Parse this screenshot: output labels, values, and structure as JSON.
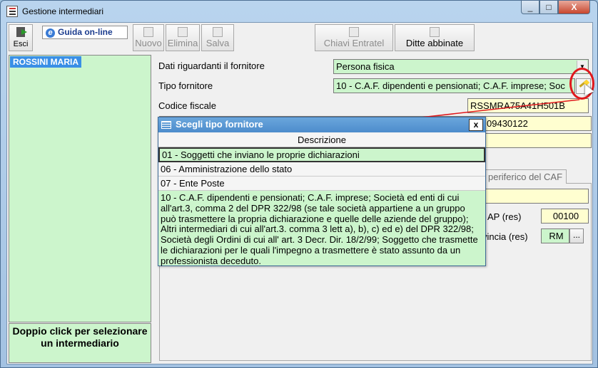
{
  "window": {
    "title": "Gestione intermediari",
    "min_label": "_",
    "max_label": "□",
    "close_label": "X"
  },
  "toolbar": {
    "esci": "Esci",
    "guida": "Guida on-line",
    "nuovo": "Nuovo",
    "elimina": "Elimina",
    "salva": "Salva",
    "chiavi_entratel": "Chiavi Entratel",
    "ditte_abbinate": "Ditte abbinate"
  },
  "list": {
    "items": [
      {
        "label": "ROSSINI MARIA"
      }
    ],
    "help": "Doppio click per selezionare un intermediario"
  },
  "form": {
    "dati_label": "Dati riguardanti il fornitore",
    "dati_value": "Persona fisica",
    "tipo_label": "Tipo fornitore",
    "tipo_value": "10 - C.A.F. dipendenti e pensionati; C.A.F. imprese; Soc",
    "cf_label": "Codice fiscale",
    "cf_value": "RSSMRA75A41H501B",
    "piva_value": "09430122",
    "tab_label": "periferico del CAF",
    "cap_label": "AP (res)",
    "cap_value": "00100",
    "prov_label": "vincia (res)",
    "prov_value": "RM",
    "prov_btn": "..."
  },
  "dialog": {
    "title": "Scegli tipo fornitore",
    "close": "x",
    "column": "Descrizione",
    "rows": [
      "01 - Soggetti che inviano le proprie dichiarazioni",
      "06 - Amministrazione dello stato",
      "07 - Ente Poste",
      "10 - C.A.F. dipendenti e pensionati; C.A.F. imprese; Società ed enti di cui all'art.3, comma 2 del DPR 322/98 (se tale società appartiene a un gruppo può trasmettere la propria dichiarazione e quelle delle aziende del gruppo); Altri intermediari di cui all'art.3. comma 3 lett a), b), c) ed e) del DPR 322/98; Società degli Ordini di cui all' art. 3 Decr. Dir. 18/2/99; Soggetto che trasmette le dichiarazioni per le quali l'impegno a trasmettere è stato assunto da un professionista deceduto."
    ]
  },
  "colors": {
    "field_green": "#ccf5cc",
    "field_yellow": "#fffed0",
    "selection_blue": "#3a8fe6",
    "annotation_red": "#e0181c"
  }
}
